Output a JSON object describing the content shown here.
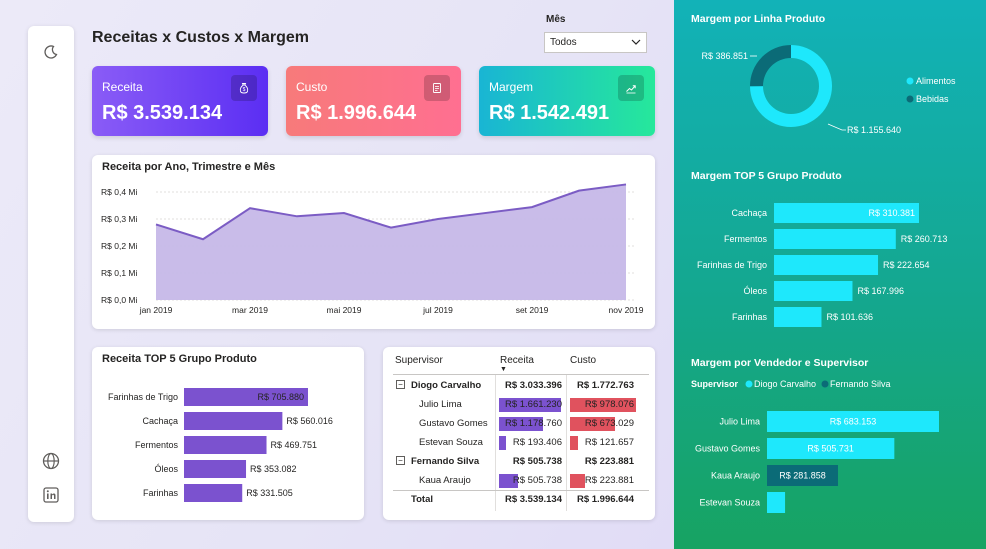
{
  "page": {
    "title": "Receitas x Custos x Margem"
  },
  "nav": {
    "items": [
      {
        "name": "theme-toggle-icon"
      },
      {
        "name": "globe-icon"
      },
      {
        "name": "linkedin-icon"
      }
    ]
  },
  "slicer": {
    "label": "Mês",
    "value": "Todos"
  },
  "kpis": [
    {
      "id": "receita",
      "label": "Receita",
      "value": "R$ 3.539.134",
      "icon": "money-bag-icon",
      "gradient": [
        "#8a5cf6",
        "#5b2ef3"
      ]
    },
    {
      "id": "custo",
      "label": "Custo",
      "value": "R$ 1.996.644",
      "icon": "document-icon",
      "gradient": [
        "#f77a7a",
        "#ff6f91"
      ]
    },
    {
      "id": "margem",
      "label": "Margem",
      "value": "R$ 1.542.491",
      "icon": "chart-up-icon",
      "gradient": [
        "#19b5d4",
        "#26e89b"
      ]
    }
  ],
  "revenue_chart": {
    "title": "Receita por Ano, Trimestre e Mês",
    "chart_data": {
      "type": "area",
      "x": [
        "jan 2019",
        "fev 2019",
        "mar 2019",
        "abr 2019",
        "mai 2019",
        "jun 2019",
        "jul 2019",
        "ago 2019",
        "set 2019",
        "out 2019",
        "nov 2019"
      ],
      "values": [
        0.28,
        0.225,
        0.34,
        0.31,
        0.322,
        0.268,
        0.3,
        0.322,
        0.344,
        0.405,
        0.428
      ],
      "ylim": [
        0,
        0.4
      ],
      "yticks": [
        "R$ 0,0 Mi",
        "R$ 0,1 Mi",
        "R$ 0,2 Mi",
        "R$ 0,3 Mi",
        "R$ 0,4 Mi"
      ],
      "xticks": [
        "jan 2019",
        "mar 2019",
        "mai 2019",
        "jul 2019",
        "set 2019",
        "nov 2019"
      ],
      "color": "#7b5cc4",
      "fill": "#c6b8e8"
    }
  },
  "top5_receita": {
    "title": "Receita TOP 5 Grupo Produto",
    "chart_data": {
      "type": "bar",
      "orientation": "horizontal",
      "categories": [
        "Farinhas de Trigo",
        "Cachaça",
        "Fermentos",
        "Óleos",
        "Farinhas"
      ],
      "values": [
        705880,
        560016,
        469751,
        353082,
        331505
      ],
      "labels": [
        "R$ 705.880",
        "R$ 560.016",
        "R$ 469.751",
        "R$ 353.082",
        "R$ 331.505"
      ],
      "color": "#7b52cf"
    }
  },
  "matrix": {
    "headers": [
      "Supervisor",
      "Receita",
      "Custo"
    ],
    "rows": [
      {
        "type": "group",
        "name": "Diogo Carvalho",
        "receita": "R$ 3.033.396",
        "custo": "R$ 1.772.763",
        "r": 3033396,
        "c": 1772763
      },
      {
        "type": "child",
        "name": "Julio Lima",
        "receita": "R$ 1.661.230",
        "custo": "R$ 978.076",
        "r": 1661230,
        "c": 978076
      },
      {
        "type": "child",
        "name": "Gustavo Gomes",
        "receita": "R$ 1.178.760",
        "custo": "R$ 673.029",
        "r": 1178760,
        "c": 673029
      },
      {
        "type": "child",
        "name": "Estevan Souza",
        "receita": "R$ 193.406",
        "custo": "R$ 121.657",
        "r": 193406,
        "c": 121657
      },
      {
        "type": "group",
        "name": "Fernando Silva",
        "receita": "R$ 505.738",
        "custo": "R$ 223.881",
        "r": 505738,
        "c": 223881
      },
      {
        "type": "child",
        "name": "Kaua Araujo",
        "receita": "R$ 505.738",
        "custo": "R$ 223.881",
        "r": 505738,
        "c": 223881
      },
      {
        "type": "total",
        "name": "Total",
        "receita": "R$ 3.539.134",
        "custo": "R$ 1.996.644"
      }
    ],
    "colors": {
      "receita": "#7b52cf",
      "custo": "#e0525e"
    }
  },
  "margem_linha": {
    "title": "Margem por Linha Produto",
    "chart_data": {
      "type": "pie",
      "categories": [
        "Alimentos",
        "Bebidas"
      ],
      "values": [
        1155640,
        386851
      ],
      "labels": [
        "R$ 1.155.640",
        "R$ 386.851"
      ],
      "colors": [
        "#1ee8fc",
        "#0b6b77"
      ]
    }
  },
  "margem_top5": {
    "title": "Margem TOP 5 Grupo Produto",
    "chart_data": {
      "type": "bar",
      "orientation": "horizontal",
      "categories": [
        "Cachaça",
        "Fermentos",
        "Farinhas de Trigo",
        "Óleos",
        "Farinhas"
      ],
      "values": [
        310381,
        260713,
        222654,
        167996,
        101636
      ],
      "labels": [
        "R$ 310.381",
        "R$ 260.713",
        "R$ 222.654",
        "R$ 167.996",
        "R$ 101.636"
      ],
      "color": "#1ee8fc"
    }
  },
  "margem_vendedor": {
    "title": "Margem por Vendedor e Supervisor",
    "legend_title": "Supervisor",
    "chart_data": {
      "type": "bar",
      "orientation": "horizontal",
      "categories": [
        "Julio Lima",
        "Gustavo Gomes",
        "Kaua Araujo",
        "Estevan Souza"
      ],
      "values": [
        683153,
        505731,
        281858,
        71749
      ],
      "labels": [
        "R$ 683.153",
        "R$ 505.731",
        "R$ 281.858",
        ""
      ],
      "series_names": [
        "Diogo Carvalho",
        "Fernando Silva"
      ],
      "series_index": [
        0,
        0,
        1,
        0
      ],
      "colors": [
        "#1ee8fc",
        "#0b6b77"
      ]
    }
  }
}
